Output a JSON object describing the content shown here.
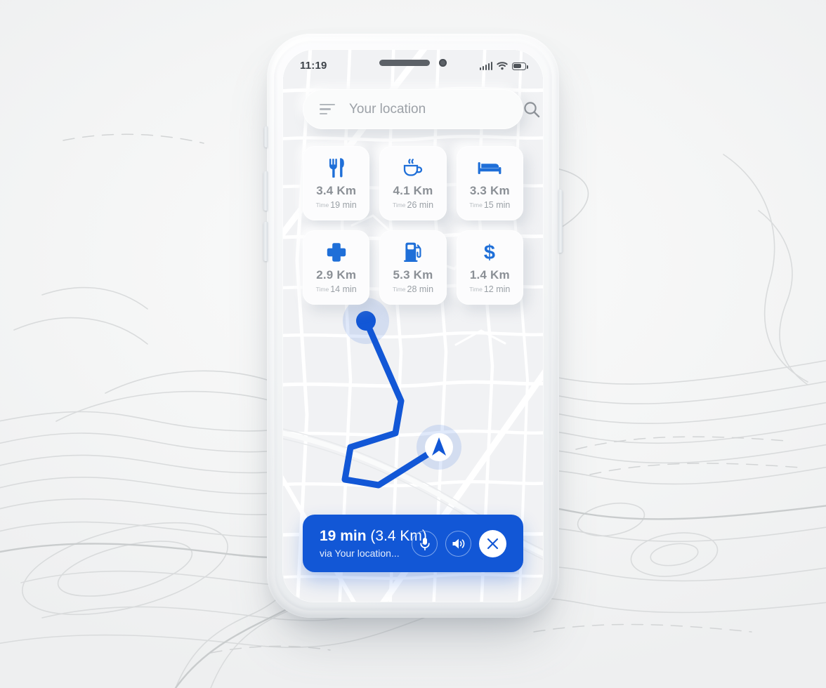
{
  "theme": {
    "accent": "#1257d6",
    "accent_light": "#3b7ae4",
    "background": "#f2f3f3",
    "card_bg": "#fcfcfd",
    "text_muted": "#8b9096"
  },
  "status_bar": {
    "time": "11:19",
    "signal_icon": "signal-bars-icon",
    "wifi_icon": "wifi-icon",
    "battery_icon": "battery-icon"
  },
  "search": {
    "placeholder": "Your location",
    "value": "",
    "filter_icon": "filter-lines-icon",
    "search_icon": "search-icon"
  },
  "categories": [
    {
      "icon": "restaurant-icon",
      "distance": "3.4 Km",
      "time_label": "Time",
      "time": "19 min"
    },
    {
      "icon": "cafe-icon",
      "distance": "4.1 Km",
      "time_label": "Time",
      "time": "26 min"
    },
    {
      "icon": "hotel-icon",
      "distance": "3.3 Km",
      "time_label": "Time",
      "time": "15 min"
    },
    {
      "icon": "hospital-icon",
      "distance": "2.9 Km",
      "time_label": "Time",
      "time": "14 min"
    },
    {
      "icon": "gas-station-icon",
      "distance": "5.3 Km",
      "time_label": "Time",
      "time": "28 min"
    },
    {
      "icon": "atm-icon",
      "distance": "1.4 Km",
      "time_label": "Time",
      "time": "12 min"
    }
  ],
  "map": {
    "origin_marker": "origin-dot-icon",
    "destination_marker": "navigation-arrow-icon",
    "route_color": "#1257d6"
  },
  "navigation_bar": {
    "eta": "19 min",
    "distance": "(3.4 Km)",
    "via": "via Your location...",
    "mic_icon": "microphone-icon",
    "sound_icon": "speaker-icon",
    "close_icon": "close-icon"
  }
}
